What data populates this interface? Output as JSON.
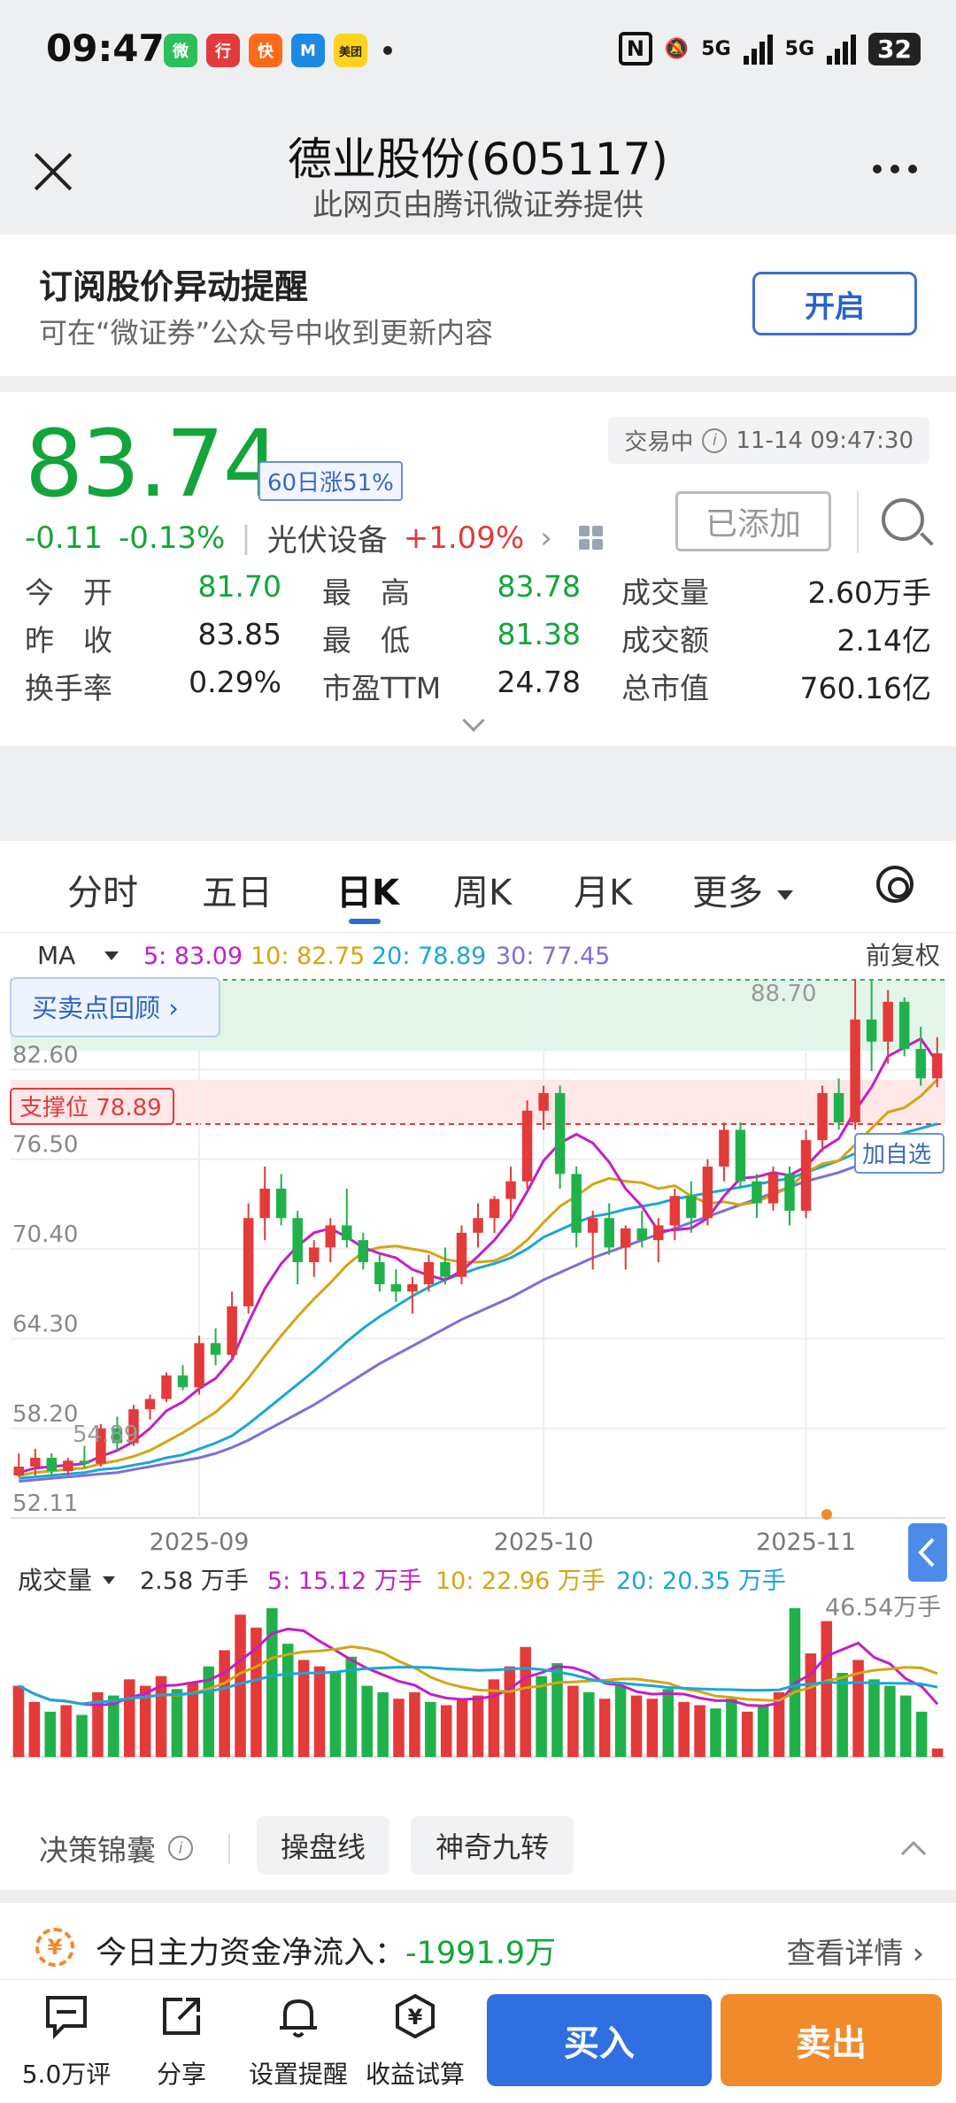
{
  "status_bar": {
    "time": "09:47",
    "apps": [
      {
        "name": "wechat-icon",
        "label": "微",
        "color": "#2dc05a"
      },
      {
        "name": "bank-app-icon",
        "label": "行",
        "color": "#e23b3b"
      },
      {
        "name": "kuaishou-icon",
        "label": "快",
        "color": "#ff6a1a"
      },
      {
        "name": "m-app-icon",
        "label": "M",
        "color": "#1e88e5"
      },
      {
        "name": "meituan-icon",
        "label": "美团",
        "color": "#ffd21f"
      }
    ],
    "net1": "5G",
    "net2": "5G",
    "battery": "32"
  },
  "title_bar": {
    "title": "德业股份(605117)",
    "subtitle": "此网页由腾讯微证券提供"
  },
  "subscribe": {
    "title": "订阅股价异动提醒",
    "desc": "可在“微证券”公众号中收到更新内容",
    "button": "开启"
  },
  "quote": {
    "price": "83.74",
    "badge": "60日涨51%",
    "status": "交易中",
    "time": "11-14 09:47:30",
    "change": "-0.11",
    "change_pct": "-0.13%",
    "sector": "光伏设备",
    "sector_change": "+1.09%",
    "added_label": "已添加",
    "stats": [
      [
        {
          "label": "今　开",
          "value": "81.70",
          "color": "green"
        },
        {
          "label": "最　高",
          "value": "83.78",
          "color": "green"
        },
        {
          "label": "成交量",
          "value": "2.60万手",
          "color": "black"
        }
      ],
      [
        {
          "label": "昨　收",
          "value": "83.85",
          "color": "black"
        },
        {
          "label": "最　低",
          "value": "81.38",
          "color": "green"
        },
        {
          "label": "成交额",
          "value": "2.14亿",
          "color": "black"
        }
      ],
      [
        {
          "label": "换手率",
          "value": "0.29%",
          "color": "black"
        },
        {
          "label": "市盈TTM",
          "value": "24.78",
          "color": "black"
        },
        {
          "label": "总市值",
          "value": "760.16亿",
          "color": "black"
        }
      ]
    ]
  },
  "tabs": [
    {
      "label": "分时",
      "active": false
    },
    {
      "label": "五日",
      "active": false
    },
    {
      "label": "日K",
      "active": true
    },
    {
      "label": "周K",
      "active": false
    },
    {
      "label": "月K",
      "active": false
    },
    {
      "label": "更多",
      "active": false
    }
  ],
  "chart_labels": {
    "ma_selector": "MA",
    "ma5": "5: 83.09",
    "ma10": "10: 82.75",
    "ma20": "20: 78.89",
    "ma30": "30: 77.45",
    "adjust": "前复权",
    "review_btn": "买卖点回顾 ›",
    "support": "支撑位 78.89",
    "add_watch": "加自选",
    "high_marker": "88.70",
    "low_marker": "54.89",
    "vol_selector": "成交量",
    "vol_now": "2.58 万手",
    "vol5": "5: 15.12 万手",
    "vol10": "10: 22.96 万手",
    "vol20": "20: 20.35 万手",
    "vol_max": "46.54万手"
  },
  "chart_data": {
    "type": "candlestick",
    "y_ticks": [
      82.6,
      76.5,
      70.4,
      64.3,
      58.2,
      52.11
    ],
    "ylim": [
      52.11,
      88.7
    ],
    "x_ticks": [
      "2025-09",
      "2025-10",
      "2025-11"
    ],
    "x_tick_index": [
      11,
      32,
      48
    ],
    "support_level": 78.89,
    "candles": [
      [
        55.0,
        56.5,
        54.9,
        55.6
      ],
      [
        55.6,
        56.8,
        55.0,
        56.2
      ],
      [
        56.2,
        56.5,
        54.9,
        55.3
      ],
      [
        55.3,
        56.2,
        55.0,
        56.0
      ],
      [
        56.0,
        57.0,
        55.5,
        55.8
      ],
      [
        55.8,
        58.5,
        55.6,
        58.2
      ],
      [
        58.2,
        59.0,
        56.7,
        57.2
      ],
      [
        57.2,
        59.8,
        57.0,
        59.5
      ],
      [
        59.5,
        60.5,
        58.8,
        60.2
      ],
      [
        60.2,
        62.0,
        60.0,
        61.8
      ],
      [
        61.8,
        62.5,
        60.8,
        61.0
      ],
      [
        61.0,
        64.5,
        60.5,
        64.0
      ],
      [
        64.0,
        65.0,
        62.5,
        63.2
      ],
      [
        63.2,
        67.5,
        63.0,
        66.5
      ],
      [
        66.5,
        73.5,
        66.0,
        72.5
      ],
      [
        72.5,
        76.0,
        71.0,
        74.5
      ],
      [
        74.5,
        75.5,
        72.0,
        72.5
      ],
      [
        72.5,
        73.0,
        68.0,
        69.5
      ],
      [
        69.5,
        71.0,
        68.5,
        70.5
      ],
      [
        70.5,
        72.5,
        69.5,
        72.0
      ],
      [
        72.0,
        74.5,
        70.5,
        71.0
      ],
      [
        71.0,
        71.5,
        69.0,
        69.5
      ],
      [
        69.5,
        70.0,
        67.5,
        68.0
      ],
      [
        68.0,
        69.0,
        66.8,
        67.5
      ],
      [
        67.5,
        68.5,
        66.0,
        68.0
      ],
      [
        68.0,
        70.0,
        67.5,
        69.5
      ],
      [
        69.5,
        70.5,
        68.0,
        68.5
      ],
      [
        68.5,
        72.0,
        68.0,
        71.5
      ],
      [
        71.5,
        73.5,
        70.5,
        72.5
      ],
      [
        72.5,
        74.0,
        71.5,
        73.8
      ],
      [
        73.8,
        76.0,
        72.5,
        75.0
      ],
      [
        75.0,
        80.5,
        74.5,
        79.8
      ],
      [
        79.8,
        81.5,
        78.5,
        81.0
      ],
      [
        81.0,
        81.5,
        74.5,
        75.5
      ],
      [
        75.5,
        76.0,
        70.5,
        71.5
      ],
      [
        71.5,
        73.0,
        69.0,
        72.5
      ],
      [
        72.5,
        73.5,
        70.0,
        70.5
      ],
      [
        70.5,
        72.0,
        69.0,
        71.8
      ],
      [
        71.8,
        73.0,
        70.5,
        71.0
      ],
      [
        71.0,
        72.5,
        69.5,
        72.0
      ],
      [
        72.0,
        74.5,
        71.0,
        74.0
      ],
      [
        74.0,
        75.0,
        71.5,
        72.5
      ],
      [
        72.5,
        76.5,
        72.0,
        76.0
      ],
      [
        76.0,
        79.0,
        75.0,
        78.5
      ],
      [
        78.5,
        79.0,
        74.5,
        75.0
      ],
      [
        75.0,
        75.5,
        72.5,
        73.5
      ],
      [
        73.5,
        76.0,
        73.0,
        75.5
      ],
      [
        75.5,
        76.0,
        72.0,
        73.0
      ],
      [
        73.0,
        78.5,
        72.5,
        77.8
      ],
      [
        77.8,
        81.5,
        77.0,
        81.0
      ],
      [
        81.0,
        82.0,
        78.5,
        79.0
      ],
      [
        79.0,
        88.7,
        78.5,
        86.0
      ],
      [
        86.0,
        88.7,
        82.5,
        84.5
      ],
      [
        84.5,
        88.0,
        83.0,
        87.2
      ],
      [
        87.2,
        87.5,
        83.5,
        84.0
      ],
      [
        84.0,
        85.5,
        81.5,
        82.0
      ],
      [
        82.0,
        84.8,
        81.4,
        83.7
      ]
    ],
    "ma5": [
      55.2,
      55.5,
      55.6,
      55.7,
      55.8,
      56.3,
      56.7,
      57.3,
      58.2,
      59.4,
      60.0,
      60.9,
      61.6,
      62.9,
      65.4,
      67.7,
      69.4,
      70.6,
      71.5,
      71.8,
      71.2,
      70.5,
      70.1,
      69.8,
      69.0,
      68.6,
      68.3,
      68.9,
      69.9,
      71.0,
      72.4,
      74.3,
      76.4,
      77.6,
      78.2,
      77.6,
      76.3,
      74.5,
      73.3,
      71.6,
      71.7,
      71.8,
      72.5,
      74.0,
      75.2,
      75.3,
      75.6,
      75.4,
      76.0,
      77.2,
      77.9,
      79.8,
      81.4,
      83.5,
      84.1,
      84.7,
      83.1
    ],
    "ma10": [
      55.0,
      55.2,
      55.3,
      55.4,
      55.5,
      55.8,
      56.0,
      56.3,
      56.7,
      57.3,
      57.9,
      58.6,
      59.3,
      60.3,
      61.6,
      63.1,
      64.5,
      65.8,
      67.0,
      68.1,
      69.3,
      70.2,
      70.5,
      70.6,
      70.4,
      70.2,
      69.7,
      69.5,
      69.5,
      69.6,
      70.1,
      71.0,
      72.2,
      73.3,
      74.0,
      74.8,
      75.2,
      75.0,
      74.9,
      74.5,
      74.7,
      74.0,
      73.5,
      73.6,
      73.4,
      73.6,
      74.1,
      74.6,
      75.6,
      76.2,
      76.4,
      77.5,
      78.6,
      79.7,
      80.0,
      80.8,
      81.9
    ],
    "ma20": [
      54.8,
      54.9,
      55.0,
      55.1,
      55.2,
      55.4,
      55.5,
      55.7,
      55.9,
      56.2,
      56.4,
      56.8,
      57.2,
      57.7,
      58.5,
      59.4,
      60.3,
      61.2,
      62.1,
      63.1,
      64.1,
      65.0,
      65.8,
      66.5,
      67.2,
      67.8,
      68.3,
      68.7,
      69.1,
      69.4,
      69.8,
      70.4,
      71.2,
      71.7,
      72.2,
      72.6,
      72.8,
      73.1,
      73.3,
      73.5,
      73.8,
      74.0,
      74.2,
      74.4,
      74.6,
      74.8,
      75.0,
      75.2,
      75.6,
      76.0,
      76.4,
      76.9,
      77.4,
      77.9,
      78.3,
      78.6,
      78.9
    ],
    "ma30": [
      54.6,
      54.7,
      54.8,
      54.9,
      55.0,
      55.1,
      55.2,
      55.4,
      55.6,
      55.8,
      56.0,
      56.2,
      56.5,
      56.9,
      57.4,
      58.0,
      58.6,
      59.2,
      59.8,
      60.5,
      61.2,
      61.9,
      62.6,
      63.2,
      63.8,
      64.4,
      65.0,
      65.6,
      66.1,
      66.6,
      67.1,
      67.7,
      68.3,
      68.8,
      69.3,
      69.8,
      70.2,
      70.6,
      71.0,
      71.4,
      71.8,
      72.2,
      72.6,
      73.0,
      73.4,
      73.8,
      74.2,
      74.6,
      75.0,
      75.3,
      75.6,
      76.0,
      76.4,
      76.7,
      77.0,
      77.2,
      77.45
    ],
    "volume": [
      22,
      17,
      14,
      16,
      13,
      20,
      19,
      24,
      22,
      25,
      21,
      23,
      28,
      33,
      44,
      40,
      46,
      35,
      30,
      28,
      26,
      31,
      22,
      20,
      18,
      20,
      17,
      16,
      18,
      19,
      24,
      28,
      34,
      25,
      29,
      22,
      20,
      18,
      22,
      19,
      18,
      21,
      17,
      16,
      15,
      18,
      14,
      16,
      20,
      46,
      32,
      42,
      26,
      30,
      24,
      22,
      19,
      14,
      2.6
    ],
    "volume_up": [
      true,
      true,
      false,
      true,
      false,
      true,
      false,
      true,
      true,
      true,
      false,
      true,
      false,
      true,
      true,
      true,
      false,
      false,
      true,
      true,
      false,
      false,
      false,
      false,
      true,
      true,
      false,
      true,
      true,
      true,
      true,
      true,
      true,
      false,
      false,
      true,
      false,
      true,
      false,
      true,
      true,
      false,
      true,
      true,
      false,
      false,
      true,
      false,
      true,
      false,
      true,
      true,
      false,
      true,
      false,
      false,
      false,
      false,
      true
    ],
    "vol_ylim": [
      0,
      46.54
    ]
  },
  "decision_bar": {
    "label": "决策锦囊",
    "btn1": "操盘线",
    "btn2": "神奇九转"
  },
  "fund_flow": {
    "label": "今日主力资金净流入：",
    "value": "-1991.9万",
    "link": "查看详情 ›"
  },
  "bottom_bar": {
    "comments": "5.0万评",
    "share": "分享",
    "alert": "设置提醒",
    "calc": "收益试算",
    "buy": "买入",
    "sell": "卖出"
  }
}
